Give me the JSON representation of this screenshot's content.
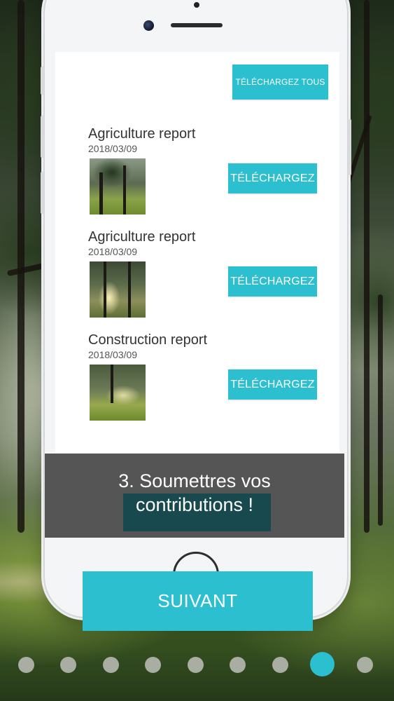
{
  "screen": {
    "download_all_label": "TÉLÉCHARGEZ TOUS",
    "reports": [
      {
        "title": "Agriculture report",
        "date": "2018/03/09",
        "download_label": "TÉLÉCHARGEZ"
      },
      {
        "title": "Agriculture report",
        "date": "2018/03/09",
        "download_label": "TÉLÉCHARGEZ"
      },
      {
        "title": "Construction report",
        "date": "2018/03/09",
        "download_label": "TÉLÉCHARGEZ"
      }
    ]
  },
  "caption": {
    "line1": "3. Soumettres vos",
    "line2": "contributions !"
  },
  "next_button_label": "SUIVANT",
  "pager": {
    "total": 9,
    "active_index": 7
  },
  "colors": {
    "accent": "#2bbfcf",
    "caption_bg": "#4a4a4a",
    "caption_highlight": "#17494e",
    "phone_frame": "#f4f5f6"
  }
}
